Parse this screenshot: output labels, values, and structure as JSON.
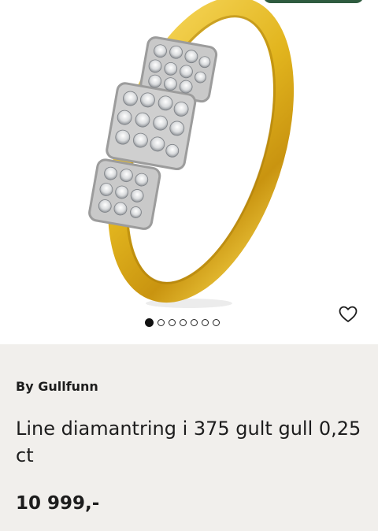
{
  "product": {
    "brand": "By Gullfunn",
    "title": "Line diamantring i 375 gult gull 0,25 ct",
    "price": "10 999,-"
  },
  "gallery": {
    "image_count": 7,
    "active_index": 0,
    "favorite_icon": "heart-outline-icon"
  },
  "colors": {
    "gold": "#e2b51e",
    "gold_dark": "#b8860b",
    "page_background": "#f1efec",
    "badge": "#2e5b3f"
  }
}
